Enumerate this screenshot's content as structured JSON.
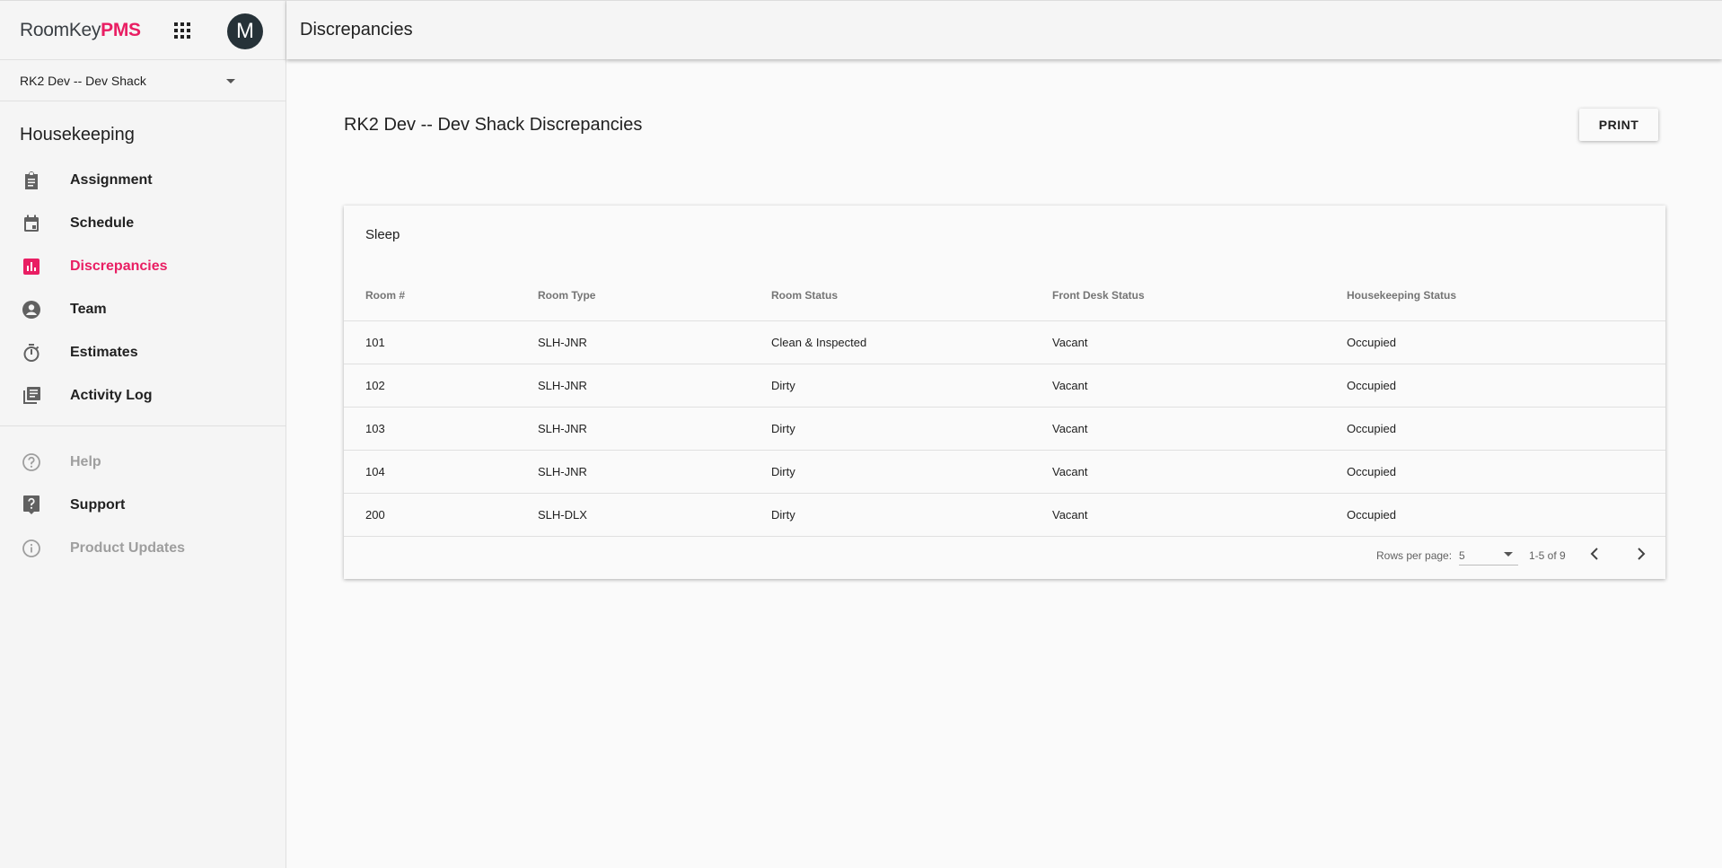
{
  "brand": {
    "part1": "RoomKey",
    "part2": "PMS"
  },
  "user": {
    "initial": "M"
  },
  "property": {
    "selected": "RK2 Dev -- Dev Shack"
  },
  "sidebar": {
    "section_title": "Housekeeping",
    "items": [
      {
        "label": "Assignment",
        "icon": "clipboard-icon"
      },
      {
        "label": "Schedule",
        "icon": "calendar-icon"
      },
      {
        "label": "Discrepancies",
        "icon": "bar-chart-icon",
        "active": true
      },
      {
        "label": "Team",
        "icon": "account-circle-icon"
      },
      {
        "label": "Estimates",
        "icon": "timer-icon"
      },
      {
        "label": "Activity Log",
        "icon": "library-books-icon"
      }
    ],
    "secondary": [
      {
        "label": "Help",
        "icon": "help-outline-icon",
        "muted": true
      },
      {
        "label": "Support",
        "icon": "live-help-icon"
      },
      {
        "label": "Product Updates",
        "icon": "info-outline-icon",
        "muted": true
      }
    ]
  },
  "topbar": {
    "title": "Discrepancies"
  },
  "main": {
    "heading": "RK2 Dev -- Dev Shack Discrepancies",
    "print_label": "PRINT"
  },
  "table": {
    "title": "Sleep",
    "columns": [
      "Room #",
      "Room Type",
      "Room Status",
      "Front Desk Status",
      "Housekeeping Status"
    ],
    "rows": [
      [
        "101",
        "SLH-JNR",
        "Clean & Inspected",
        "Vacant",
        "Occupied"
      ],
      [
        "102",
        "SLH-JNR",
        "Dirty",
        "Vacant",
        "Occupied"
      ],
      [
        "103",
        "SLH-JNR",
        "Dirty",
        "Vacant",
        "Occupied"
      ],
      [
        "104",
        "SLH-JNR",
        "Dirty",
        "Vacant",
        "Occupied"
      ],
      [
        "200",
        "SLH-DLX",
        "Dirty",
        "Vacant",
        "Occupied"
      ]
    ],
    "pagination": {
      "rows_per_page_label": "Rows per page:",
      "rows_per_page": "5",
      "range": "1-5 of 9"
    }
  },
  "colors": {
    "accent": "#e91e63",
    "avatar": "#263238",
    "muted": "#9e9e9e"
  }
}
